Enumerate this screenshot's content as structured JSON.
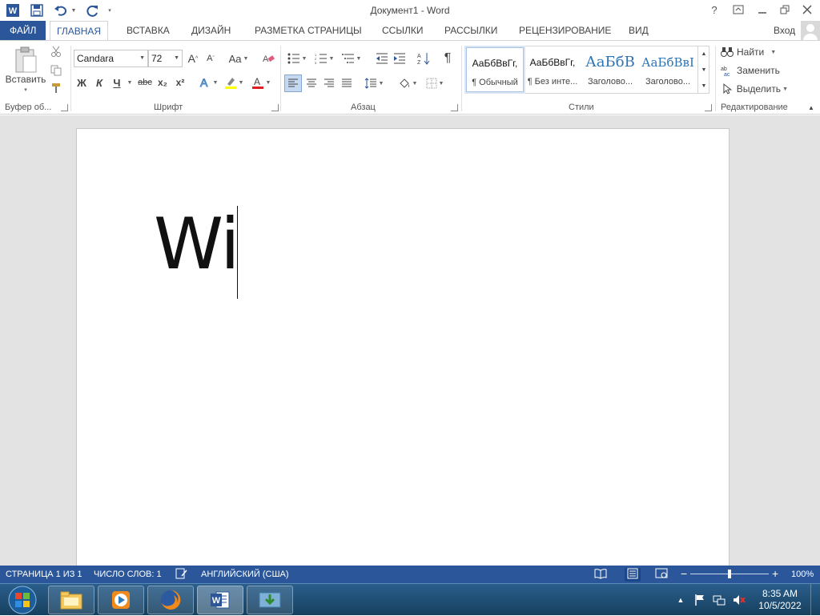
{
  "window": {
    "title": "Документ1 - Word",
    "help": "?",
    "sign_in": "Вход"
  },
  "tabs": [
    "ФАЙЛ",
    "ГЛАВНАЯ",
    "ВСТАВКА",
    "ДИЗАЙН",
    "РАЗМЕТКА СТРАНИЦЫ",
    "ССЫЛКИ",
    "РАССЫЛКИ",
    "РЕЦЕНЗИРОВАНИЕ",
    "ВИД"
  ],
  "active_tab": "ГЛАВНАЯ",
  "ribbon": {
    "clipboard": {
      "paste_label": "Вставить",
      "group_label": "Буфер об..."
    },
    "font": {
      "font_name": "Candara",
      "font_size": "72",
      "bold": "Ж",
      "italic": "К",
      "underline": "Ч",
      "strike": "abc",
      "subscript": "x₂",
      "superscript": "x²",
      "change_case": "Aa",
      "grow": "A",
      "shrink": "A",
      "group_label": "Шрифт"
    },
    "paragraph": {
      "pilcrow": "¶",
      "group_label": "Абзац"
    },
    "styles": {
      "items": [
        {
          "preview": "АаБбВвГг,",
          "name": "¶ Обычный"
        },
        {
          "preview": "АаБбВвГг,",
          "name": "¶ Без инте..."
        },
        {
          "preview": "АаБбВ",
          "name": "Заголово..."
        },
        {
          "preview": "АаБбВвІ",
          "name": "Заголово..."
        }
      ],
      "heading_color": "#2e74b5",
      "group_label": "Стили"
    },
    "editing": {
      "find": "Найти",
      "replace": "Заменить",
      "select": "Выделить",
      "group_label": "Редактирование"
    }
  },
  "document": {
    "text": "Wi"
  },
  "status": {
    "page": "СТРАНИЦА 1 ИЗ 1",
    "words": "ЧИСЛО СЛОВ: 1",
    "language": "АНГЛИЙСКИЙ (США)",
    "zoom": "100%",
    "zoom_level": 1.0
  },
  "taskbar": {
    "time": "8:35 AM",
    "date": "10/5/2022"
  },
  "colors": {
    "accent": "#2b579a",
    "taskbar": "#1f4e77"
  }
}
